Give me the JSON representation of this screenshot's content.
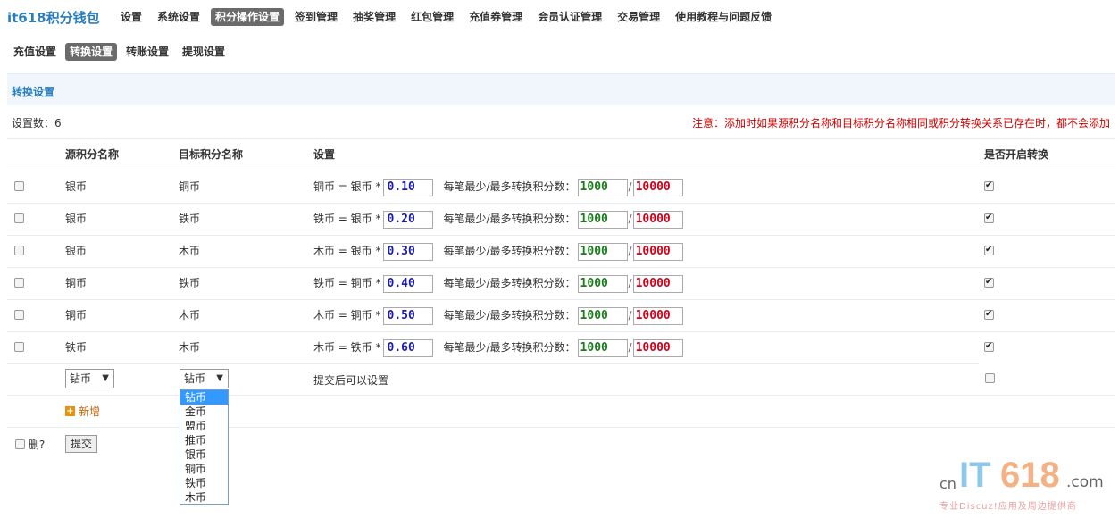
{
  "brand": "it618积分钱包",
  "topnav": [
    "设置",
    "系统设置",
    "积分操作设置",
    "签到管理",
    "抽奖管理",
    "红包管理",
    "充值券管理",
    "会员认证管理",
    "交易管理",
    "使用教程与问题反馈"
  ],
  "topnav_active": 2,
  "subnav": [
    "充值设置",
    "转换设置",
    "转账设置",
    "提现设置"
  ],
  "subnav_active": 1,
  "section_title": "转换设置",
  "count_text": "设置数：6",
  "notice": "注意：添加时如果源积分名称和目标积分名称相同或积分转换关系已存在时，都不会添加",
  "headers": {
    "source": "源积分名称",
    "target": "目标积分名称",
    "setting": "设置",
    "enabled": "是否开启转换"
  },
  "rows": [
    {
      "source": "银币",
      "target": "铜币",
      "formula": "铜币 = 银币 *",
      "rate": "0.10",
      "min": "1000",
      "max": "10000",
      "enabled": true
    },
    {
      "source": "银币",
      "target": "铁币",
      "formula": "铁币 = 银币 *",
      "rate": "0.20",
      "min": "1000",
      "max": "10000",
      "enabled": true
    },
    {
      "source": "银币",
      "target": "木币",
      "formula": "木币 = 银币 *",
      "rate": "0.30",
      "min": "1000",
      "max": "10000",
      "enabled": true
    },
    {
      "source": "铜币",
      "target": "铁币",
      "formula": "铁币 = 铜币 *",
      "rate": "0.40",
      "min": "1000",
      "max": "10000",
      "enabled": true
    },
    {
      "source": "铜币",
      "target": "木币",
      "formula": "木币 = 铜币 *",
      "rate": "0.50",
      "min": "1000",
      "max": "10000",
      "enabled": true
    },
    {
      "source": "铁币",
      "target": "木币",
      "formula": "木币 = 铁币 *",
      "rate": "0.60",
      "min": "1000",
      "max": "10000",
      "enabled": true
    }
  ],
  "min_max_label": "每笔最少/最多转换积分数：",
  "new_row": {
    "source_selected": "钻币",
    "target_selected": "钻币",
    "hint": "提交后可以设置",
    "enabled": false
  },
  "dropdown_options": [
    "钻币",
    "金币",
    "盟币",
    "推币",
    "银币",
    "铜币",
    "铁币",
    "木币"
  ],
  "dropdown_highlight": 0,
  "add_label": "新增",
  "delete_label": "删?",
  "submit_label": "提交",
  "logo": {
    "cn": "cn",
    "it": "IT",
    "num": "618",
    "com": ".com",
    "tagline": "专业Discuz!应用及周边提供商"
  }
}
